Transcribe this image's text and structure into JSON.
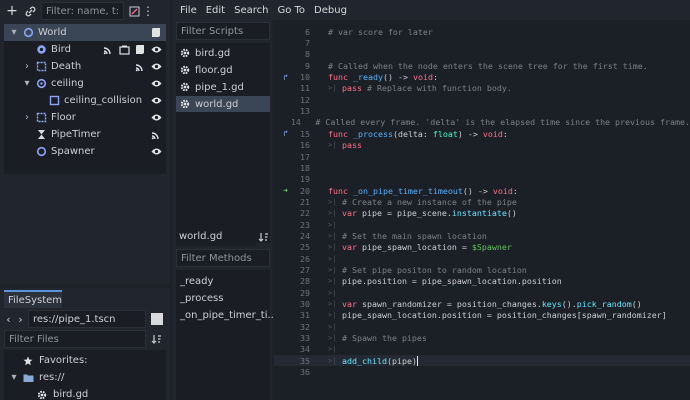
{
  "scene": {
    "search_placeholder": "Filter: name, t:t",
    "tree": [
      {
        "label": "World",
        "icon": "node2d-circle-icon",
        "indent": 0,
        "arrow": "▾",
        "selected": true,
        "badges": [
          "script-icon"
        ]
      },
      {
        "label": "Bird",
        "icon": "characterbody-icon",
        "indent": 1,
        "arrow": "",
        "selected": false,
        "badges": [
          "signal-icon",
          "group-icon",
          "script-icon",
          "visibility-icon"
        ]
      },
      {
        "label": "Death",
        "icon": "area-icon",
        "indent": 1,
        "arrow": "›",
        "selected": false,
        "badges": [
          "signal-icon",
          "visibility-icon"
        ]
      },
      {
        "label": "ceiling",
        "icon": "staticbody-icon",
        "indent": 1,
        "arrow": "▾",
        "selected": false,
        "badges": [
          "visibility-icon"
        ]
      },
      {
        "label": "ceiling_collision",
        "icon": "collision-shape-icon",
        "indent": 2,
        "arrow": "",
        "selected": false,
        "badges": [
          "visibility-icon"
        ]
      },
      {
        "label": "Floor",
        "icon": "area-icon",
        "indent": 1,
        "arrow": "›",
        "selected": false,
        "badges": [
          "visibility-icon"
        ]
      },
      {
        "label": "PipeTimer",
        "icon": "timer-icon",
        "indent": 1,
        "arrow": "",
        "selected": false,
        "badges": [
          "signal-icon"
        ]
      },
      {
        "label": "Spawner",
        "icon": "node2d-circle-icon",
        "indent": 1,
        "arrow": "",
        "selected": false,
        "badges": [
          "visibility-icon"
        ]
      }
    ]
  },
  "filesystem": {
    "tab": "FileSystem",
    "path": "res://pipe_1.tscn",
    "filter_placeholder": "Filter Files",
    "items": [
      {
        "label": "Favorites:",
        "icon": "star-icon",
        "indent": 0,
        "arrow": ""
      },
      {
        "label": "res://",
        "icon": "folder-icon",
        "indent": 0,
        "arrow": "▾"
      },
      {
        "label": "bird.gd",
        "icon": "gear-icon",
        "indent": 1,
        "arrow": ""
      }
    ]
  },
  "menu": [
    "File",
    "Edit",
    "Search",
    "Go To",
    "Debug"
  ],
  "scripts": {
    "filter_placeholder": "Filter Scripts",
    "items": [
      {
        "label": "bird.gd",
        "selected": false
      },
      {
        "label": "floor.gd",
        "selected": false
      },
      {
        "label": "pipe_1.gd",
        "selected": false
      },
      {
        "label": "world.gd",
        "selected": true
      }
    ],
    "current": "world.gd",
    "methods_placeholder": "Filter Methods",
    "methods": [
      "_ready",
      "_process",
      "_on_pipe_timer_ti..."
    ]
  },
  "code": {
    "lines": [
      {
        "n": "6",
        "mark": "",
        "tokens": [
          [
            "cm",
            "# var score for later"
          ]
        ]
      },
      {
        "n": "7",
        "mark": "",
        "tokens": []
      },
      {
        "n": "8",
        "mark": "",
        "tokens": []
      },
      {
        "n": "9",
        "mark": "",
        "tokens": [
          [
            "cm",
            "# Called when the node enters the scene tree for the first time."
          ]
        ]
      },
      {
        "n": "10",
        "mark": "↱",
        "tokens": [
          [
            "kw",
            "func "
          ],
          [
            "fnd",
            "_ready"
          ],
          [
            "txt",
            "() -> "
          ],
          [
            "kw",
            "void"
          ],
          [
            "txt",
            ":"
          ]
        ]
      },
      {
        "n": "11",
        "mark": "",
        "tokens": [
          [
            "gut",
            ">|  "
          ],
          [
            "kw",
            "pass "
          ],
          [
            "cm",
            "# Replace with function body."
          ]
        ]
      },
      {
        "n": "12",
        "mark": "",
        "tokens": []
      },
      {
        "n": "13",
        "mark": "",
        "tokens": []
      },
      {
        "n": "14",
        "mark": "",
        "tokens": [
          [
            "cm",
            "# Called every frame. 'delta' is the elapsed time since the previous frame."
          ]
        ]
      },
      {
        "n": "15",
        "mark": "↱",
        "tokens": [
          [
            "kw",
            "func "
          ],
          [
            "fnd",
            "_process"
          ],
          [
            "txt",
            "(delta: "
          ],
          [
            "ty",
            "float"
          ],
          [
            "txt",
            ") -> "
          ],
          [
            "kw",
            "void"
          ],
          [
            "txt",
            ":"
          ]
        ]
      },
      {
        "n": "16",
        "mark": "",
        "tokens": [
          [
            "gut",
            ">|  "
          ],
          [
            "kw",
            "pass"
          ]
        ]
      },
      {
        "n": "17",
        "mark": "",
        "tokens": []
      },
      {
        "n": "18",
        "mark": "",
        "tokens": []
      },
      {
        "n": "19",
        "mark": "",
        "tokens": []
      },
      {
        "n": "20",
        "mark": "➜",
        "tokens": [
          [
            "kw",
            "func "
          ],
          [
            "fnd",
            "_on_pipe_timer_timeout"
          ],
          [
            "txt",
            "() -> "
          ],
          [
            "kw",
            "void"
          ],
          [
            "txt",
            ":"
          ]
        ]
      },
      {
        "n": "21",
        "mark": "",
        "tokens": [
          [
            "gut",
            ">|  "
          ],
          [
            "cm",
            "# Create a new instance of the pipe"
          ]
        ]
      },
      {
        "n": "22",
        "mark": "",
        "tokens": [
          [
            "gut",
            ">|  "
          ],
          [
            "kw",
            "var "
          ],
          [
            "txt",
            "pipe = pipe_scene."
          ],
          [
            "fn",
            "instantiate"
          ],
          [
            "txt",
            "()"
          ]
        ]
      },
      {
        "n": "23",
        "mark": "",
        "tokens": [
          [
            "gut",
            ">|"
          ]
        ]
      },
      {
        "n": "24",
        "mark": "",
        "tokens": [
          [
            "gut",
            ">|  "
          ],
          [
            "cm",
            "# Set the main spawn location"
          ]
        ]
      },
      {
        "n": "25",
        "mark": "",
        "tokens": [
          [
            "gut",
            ">|  "
          ],
          [
            "kw",
            "var "
          ],
          [
            "txt",
            "pipe_spawn_location = "
          ],
          [
            "nd",
            "$Spawner"
          ]
        ]
      },
      {
        "n": "26",
        "mark": "",
        "tokens": [
          [
            "gut",
            ">|"
          ]
        ]
      },
      {
        "n": "27",
        "mark": "",
        "tokens": [
          [
            "gut",
            ">|  "
          ],
          [
            "cm",
            "# Set pipe positon to random location"
          ]
        ]
      },
      {
        "n": "28",
        "mark": "",
        "tokens": [
          [
            "gut",
            ">|  "
          ],
          [
            "txt",
            "pipe.position = pipe_spawn_location.position"
          ]
        ]
      },
      {
        "n": "29",
        "mark": "",
        "tokens": [
          [
            "gut",
            ">|"
          ]
        ]
      },
      {
        "n": "30",
        "mark": "",
        "tokens": [
          [
            "gut",
            ">|  "
          ],
          [
            "kw",
            "var "
          ],
          [
            "txt",
            "spawn_randomizer = position_changes."
          ],
          [
            "fn",
            "keys"
          ],
          [
            "txt",
            "()."
          ],
          [
            "fn",
            "pick_random"
          ],
          [
            "txt",
            "()"
          ]
        ]
      },
      {
        "n": "31",
        "mark": "",
        "tokens": [
          [
            "gut",
            ">|  "
          ],
          [
            "txt",
            "pipe_spawn_location.position = position_changes[spawn_randomizer]"
          ]
        ]
      },
      {
        "n": "32",
        "mark": "",
        "tokens": [
          [
            "gut",
            ">|"
          ]
        ]
      },
      {
        "n": "33",
        "mark": "",
        "tokens": [
          [
            "gut",
            ">|  "
          ],
          [
            "cm",
            "# Spawn the pipes"
          ]
        ]
      },
      {
        "n": "34",
        "mark": "",
        "tokens": [
          [
            "gut",
            ">|"
          ]
        ]
      },
      {
        "n": "35",
        "mark": "",
        "tokens": [
          [
            "gut",
            ">|  "
          ],
          [
            "fn",
            "add_child"
          ],
          [
            "txt",
            "(pipe)"
          ]
        ]
      },
      {
        "n": "36",
        "mark": "",
        "tokens": []
      }
    ]
  }
}
